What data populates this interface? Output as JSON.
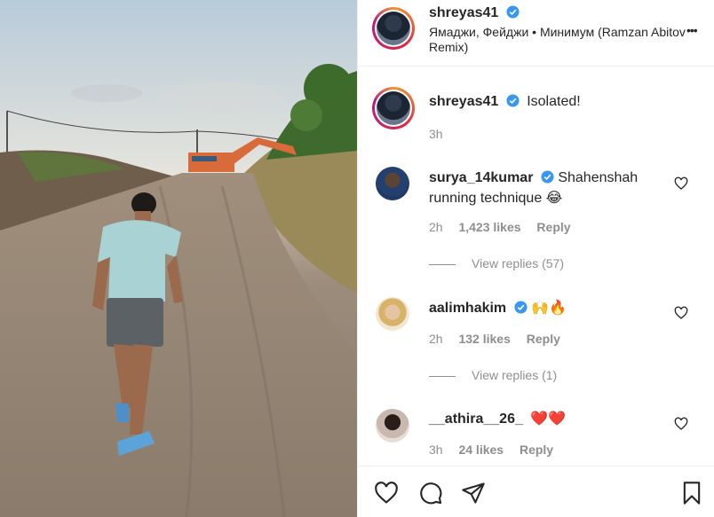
{
  "post": {
    "username": "shreyas41",
    "audio": "Ямаджи, Фейджи • Минимум (Ramzan Abitov Remix)",
    "more_label": "•••",
    "caption": "Isolated!",
    "caption_time": "3h"
  },
  "comments": [
    {
      "username": "surya_14kumar",
      "verified": true,
      "text": "Shahenshah running technique",
      "emoji": "😂",
      "time": "2h",
      "likes": "1,423 likes",
      "reply": "Reply",
      "view_replies": "View replies (57)"
    },
    {
      "username": "aalimhakim",
      "verified": true,
      "text": "",
      "emoji": "🙌🔥",
      "time": "2h",
      "likes": "132 likes",
      "reply": "Reply",
      "view_replies": "View replies (1)"
    },
    {
      "username": "__athira__26_",
      "verified": false,
      "text": "",
      "emoji": "❤️❤️",
      "time": "3h",
      "likes": "24 likes",
      "reply": "Reply"
    }
  ],
  "icons": {
    "like": "heart-icon",
    "comment": "comment-icon",
    "share": "share-icon",
    "save": "bookmark-icon",
    "verified": "verified-badge-icon"
  },
  "colors": {
    "verified_blue": "#3897f0",
    "heart_red": "#ed4956",
    "text": "#262626",
    "muted": "#8e8e8e"
  }
}
